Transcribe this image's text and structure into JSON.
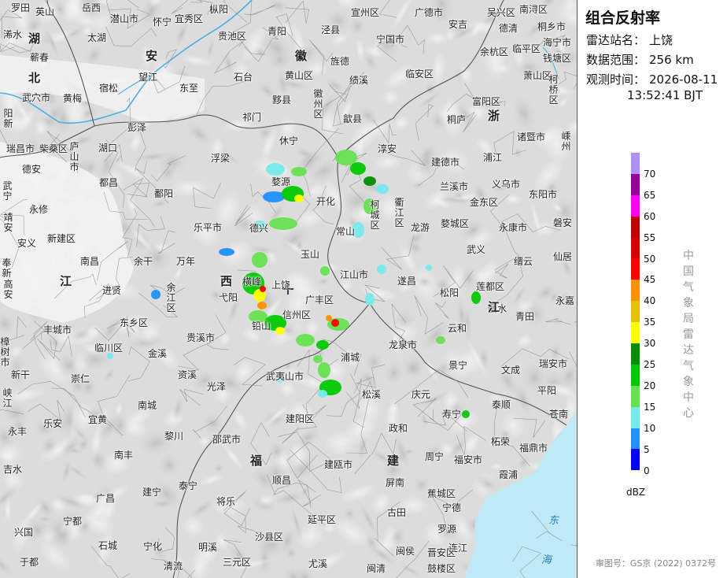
{
  "product": {
    "title": "组合反射率",
    "station_label": "雷达站名：",
    "station_value": "上饶",
    "range_label": "数据范围：",
    "range_value": "256 km",
    "time_label": "观测时间：",
    "time_value_date": "2026-08-11",
    "time_value_clock": "13:52:41 BJT"
  },
  "legend": {
    "unit": "dBZ",
    "levels": [
      {
        "label": "70",
        "color": "#ad90f0"
      },
      {
        "label": "65",
        "color": "#96009a"
      },
      {
        "label": "60",
        "color": "#ff00f0"
      },
      {
        "label": "55",
        "color": "#c00000"
      },
      {
        "label": "50",
        "color": "#d60000"
      },
      {
        "label": "45",
        "color": "#ff0000"
      },
      {
        "label": "40",
        "color": "#ff9000"
      },
      {
        "label": "35",
        "color": "#e7c000"
      },
      {
        "label": "30",
        "color": "#ffff00"
      },
      {
        "label": "25",
        "color": "#008e00"
      },
      {
        "label": "20",
        "color": "#00c800"
      },
      {
        "label": "15",
        "color": "#66e050"
      },
      {
        "label": "10",
        "color": "#76eaea"
      },
      {
        "label": "5",
        "color": "#1e90ff"
      },
      {
        "label": "0",
        "color": "#0000f6"
      }
    ]
  },
  "agency": "中国气象局雷达气象中心",
  "approval": "审图号：GS京 (2022) 0372号",
  "provinces": [
    "湖",
    "北",
    "安",
    "徽",
    "浙",
    "江",
    "西",
    "福",
    "建"
  ],
  "seas": [
    "东",
    "海"
  ],
  "places": [
    "罗田",
    "英山",
    "岳西",
    "潜山市",
    "怀宁",
    "宜秀区",
    "枞阳",
    "贵池区",
    "宣州区",
    "广德市",
    "吴兴区",
    "南浔区",
    "浠水",
    "太湖",
    "望江",
    "东至",
    "石台",
    "青阳",
    "泾县",
    "宁国市",
    "安吉",
    "德清",
    "桐乡市",
    "海宁市",
    "蕲春",
    "宿松",
    "黄梅",
    "武穴市",
    "黄山区",
    "旌德",
    "临安区",
    "余杭区",
    "临平区",
    "钱塘区",
    "彭泽",
    "祁门",
    "黟县",
    "徽州区",
    "歙县",
    "绩溪",
    "富阳区",
    "萧山区",
    "柯桥区",
    "阳新",
    "瑞昌市",
    "柴桑区",
    "庐山市",
    "湖口",
    "休宁",
    "淳安",
    "桐庐",
    "诸暨市",
    "嵊州",
    "德安",
    "都昌",
    "浮梁",
    "婺源",
    "建德市",
    "浦江",
    "兰溪市",
    "义乌市",
    "东阳市",
    "武宁",
    "鄱阳",
    "开化",
    "金东区",
    "永修",
    "常山",
    "衢江区",
    "龙游",
    "婺城区",
    "永康市",
    "磐安",
    "靖安",
    "乐平市",
    "德兴",
    "柯城区",
    "新建区",
    "安义",
    "玉山",
    "武义",
    "缙云",
    "仙居",
    "奉新",
    "南昌",
    "余干",
    "万年",
    "江山市",
    "遂昌",
    "松阳",
    "莲都区",
    "高安",
    "进贤",
    "横峰",
    "余江区",
    "弋阳",
    "上饶",
    "广丰区",
    "青田",
    "永嘉",
    "丰城市",
    "信州区",
    "铅山",
    "云和",
    "樟树市",
    "东乡区",
    "贵溪市",
    "龙泉市",
    "丽水",
    "临川区",
    "金溪",
    "浦城",
    "景宁",
    "文成",
    "瑞安市",
    "新干",
    "崇仁",
    "资溪",
    "光泽",
    "武夷山市",
    "庆元",
    "泰顺",
    "平阳",
    "峡江",
    "南城",
    "松溪",
    "寿宁",
    "苍南",
    "永丰",
    "乐安",
    "宜黄",
    "建阳区",
    "政和",
    "福鼎市",
    "黎川",
    "南丰",
    "邵武市",
    "建瓯市",
    "周宁",
    "福安市",
    "柘荣",
    "霞浦",
    "吉水",
    "广昌",
    "泰宁",
    "建宁",
    "将乐",
    "顺昌",
    "屏南",
    "蕉城区",
    "古田",
    "宁德",
    "罗源",
    "连江",
    "兴国",
    "宁都",
    "石城",
    "宁化",
    "明溪",
    "沙县区",
    "延平区",
    "闽侯",
    "闽清",
    "晋安区",
    "于都",
    "清流",
    "三元区",
    "尤溪",
    "鼓楼区"
  ]
}
